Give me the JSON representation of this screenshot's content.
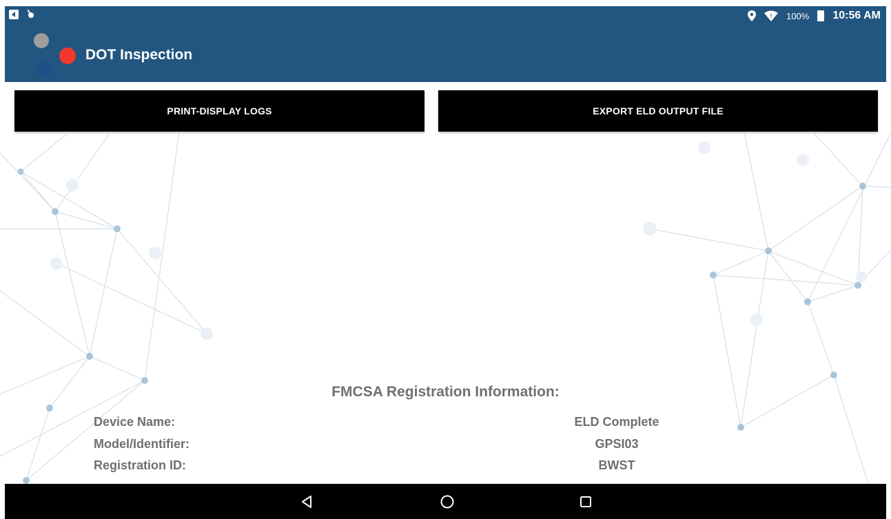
{
  "status_bar": {
    "battery": "100%",
    "time": "10:56 AM",
    "icons": [
      "notification-app-icon",
      "notification-bell-icon",
      "location-icon",
      "wifi-icon",
      "battery-icon"
    ]
  },
  "app_bar": {
    "title": "DOT Inspection",
    "color": "#225580"
  },
  "actions": {
    "print_label": "PRINT-DISPLAY LOGS",
    "export_label": "EXPORT ELD OUTPUT FILE"
  },
  "registration": {
    "heading": "FMCSA Registration Information:",
    "rows": [
      {
        "label": "Device Name:",
        "value": "ELD Complete"
      },
      {
        "label": "Model/Identifier:",
        "value": "GPSI03"
      },
      {
        "label": "Registration ID:",
        "value": "BWST"
      }
    ]
  },
  "nav_bar": {
    "buttons": [
      "back-icon",
      "home-icon",
      "recents-icon"
    ]
  }
}
